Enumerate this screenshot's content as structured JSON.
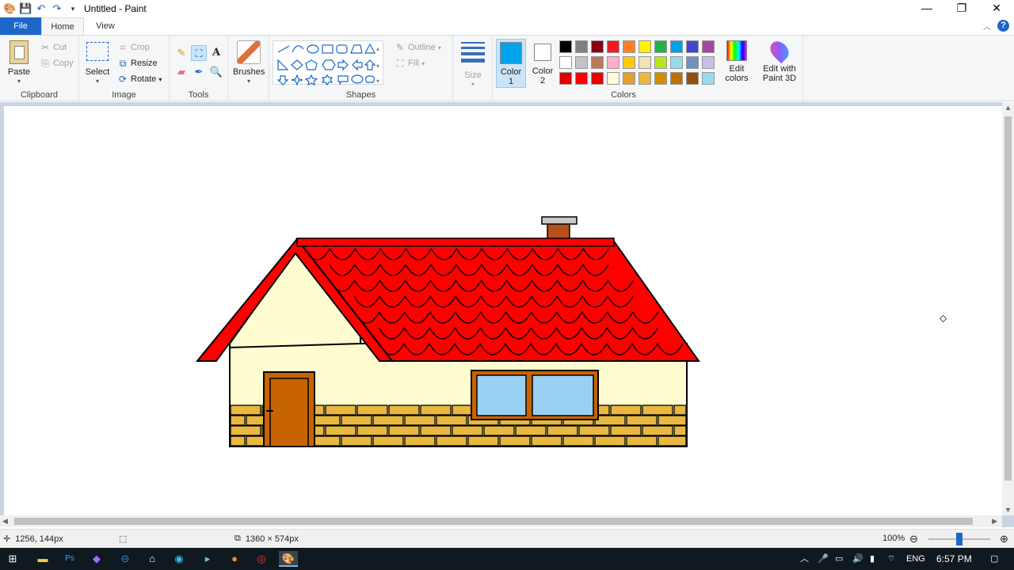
{
  "window": {
    "title": "Untitled - Paint",
    "controls": [
      "—",
      "❐",
      "✕"
    ]
  },
  "quick_access": [
    "paint-logo-icon",
    "save-icon",
    "undo-icon",
    "redo-icon",
    "customize-icon"
  ],
  "tabs": {
    "file": "File",
    "home": "Home",
    "view": "View"
  },
  "ribbon": {
    "clipboard": {
      "label": "Clipboard",
      "paste": "Paste",
      "cut": "Cut",
      "copy": "Copy"
    },
    "image": {
      "label": "Image",
      "select": "Select",
      "crop": "Crop",
      "resize": "Resize",
      "rotate": "Rotate"
    },
    "tools": {
      "label": "Tools",
      "selected": "fill-bucket"
    },
    "brushes": {
      "label": "Brushes"
    },
    "shapes": {
      "label": "Shapes",
      "outline": "Outline",
      "fill": "Fill"
    },
    "size": {
      "label": "Size"
    },
    "colors": {
      "label": "Colors",
      "color1_label": "Color",
      "color1_num": "1",
      "color2_label": "Color",
      "color2_num": "2",
      "color1_value": "#00a2e8",
      "color2_value": "#ffffff",
      "edit_colors_line1": "Edit",
      "edit_colors_line2": "colors",
      "edit_paint3d_line1": "Edit with",
      "edit_paint3d_line2": "Paint 3D",
      "palette": [
        "#000000",
        "#7f7f7f",
        "#880015",
        "#ed1c24",
        "#ff7f27",
        "#fff200",
        "#22b14c",
        "#00a2e8",
        "#3f48cc",
        "#a349a4",
        "#ffffff",
        "#c3c3c3",
        "#b97a57",
        "#ffaec9",
        "#ffc90e",
        "#efe4b0",
        "#b5e61d",
        "#99d9ea",
        "#7092be",
        "#c8bfe7",
        "#e00000",
        "#ff0000",
        "#e60000",
        "#fffadc",
        "#e0a030",
        "#e8b840",
        "#d09000",
        "#c07000",
        "#905010",
        "#99d9ea"
      ]
    }
  },
  "status": {
    "cursor_pos": "1256, 144px",
    "image_size": "1360 × 574px",
    "zoom": "100%"
  },
  "taskbar": {
    "language": "ENG",
    "time": "6:57 PM"
  },
  "drawing": {
    "roof_color": "#ff0000",
    "wall_color": "#fffdd0",
    "brick_color": "#e8b840",
    "door_color": "#c86400",
    "window_color": "#99d1f5",
    "chimney_color": "#b5501a"
  }
}
